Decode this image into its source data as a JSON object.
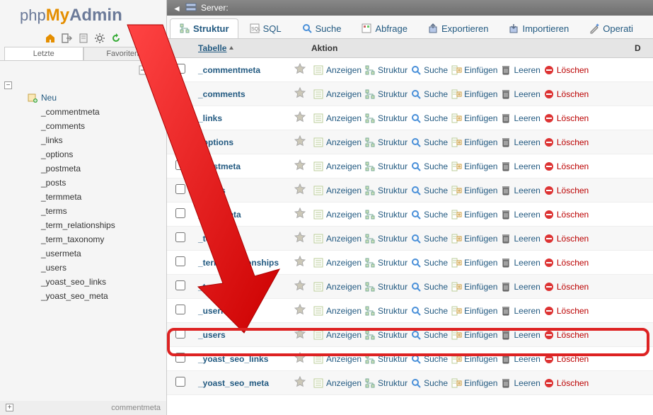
{
  "logo": {
    "php": "php",
    "my": "My",
    "admin": "Admin"
  },
  "recent_tabs": {
    "letzte": "Letzte",
    "favoriten": "Favoriten"
  },
  "sidebar": {
    "neu": "Neu",
    "tables": [
      "_commentmeta",
      "_comments",
      "_links",
      "_options",
      "_postmeta",
      "_posts",
      "_termmeta",
      "_terms",
      "_term_relationships",
      "_term_taxonomy",
      "_usermeta",
      "_users",
      "_yoast_seo_links",
      "_yoast_seo_meta"
    ],
    "bottom": "commentmeta"
  },
  "breadcrumb": {
    "server_label": "Server:"
  },
  "tabs": [
    {
      "label": "Struktur",
      "active": true
    },
    {
      "label": "SQL"
    },
    {
      "label": "Suche"
    },
    {
      "label": "Abfrage"
    },
    {
      "label": "Exportieren"
    },
    {
      "label": "Importieren"
    },
    {
      "label": "Operati"
    }
  ],
  "thead": {
    "tabelle": "Tabelle",
    "aktion": "Aktion",
    "d": "D"
  },
  "action_labels": {
    "anzeigen": "Anzeigen",
    "struktur": "Struktur",
    "suche": "Suche",
    "einfuegen": "Einfügen",
    "leeren": "Leeren",
    "loeschen": "Löschen"
  },
  "table_rows": [
    "_commentmeta",
    "_comments",
    "_links",
    "_options",
    "_postmeta",
    "_posts",
    "_termmeta",
    "_terms",
    "_term_relationships",
    "_term_taxonomy",
    "_usermeta",
    "_users",
    "_yoast_seo_links",
    "_yoast_seo_meta"
  ],
  "highlight_index": 11
}
